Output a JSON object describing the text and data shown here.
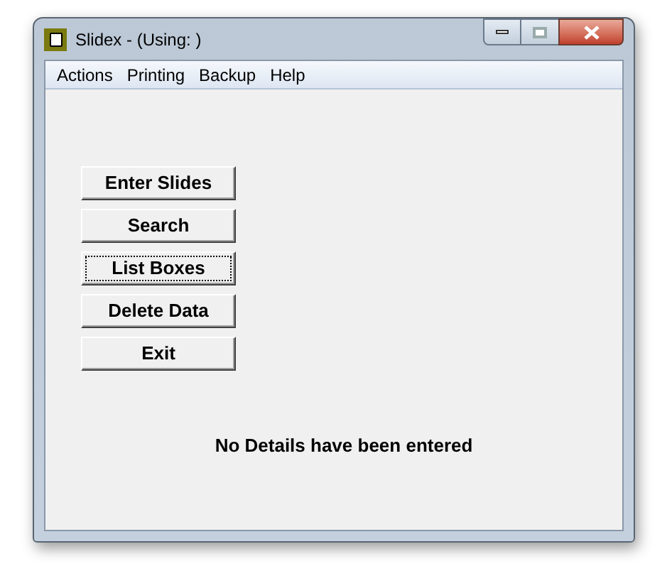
{
  "window": {
    "title": "Slidex - (Using: )"
  },
  "menu": [
    "Actions",
    "Printing",
    "Backup",
    "Help"
  ],
  "buttons": [
    {
      "label": "Enter Slides",
      "focused": false
    },
    {
      "label": "Search",
      "focused": false
    },
    {
      "label": "List Boxes",
      "focused": true
    },
    {
      "label": "Delete Data",
      "focused": false
    },
    {
      "label": "Exit",
      "focused": false
    }
  ],
  "status_message": "No Details have been entered"
}
